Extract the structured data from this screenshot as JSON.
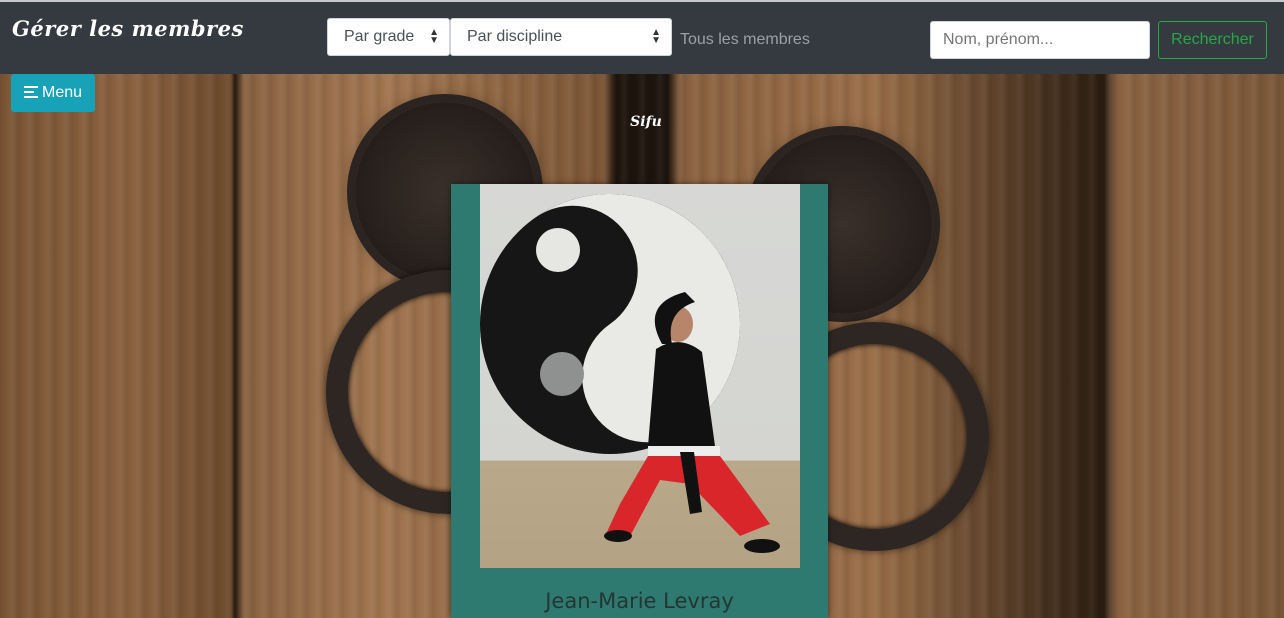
{
  "header": {
    "brand": "Gérer les membres",
    "grade_select": {
      "selected": "Par grade"
    },
    "discipline_select": {
      "selected": "Par discipline"
    },
    "filter_label": "Tous les membres",
    "search": {
      "placeholder": "Nom, prénom...",
      "value": ""
    },
    "search_button_label": "Rechercher"
  },
  "menu_button_label": "Menu",
  "section_title": "Sifu",
  "member": {
    "name": "Jean-Marie Levray"
  },
  "colors": {
    "topbar": "#343a40",
    "menu_button": "#17a2b8",
    "search_button": "#28a745",
    "card": "#2f7a70"
  },
  "icons": {
    "menu": "align-left-icon",
    "select_arrow": "sort-arrows-icon"
  }
}
